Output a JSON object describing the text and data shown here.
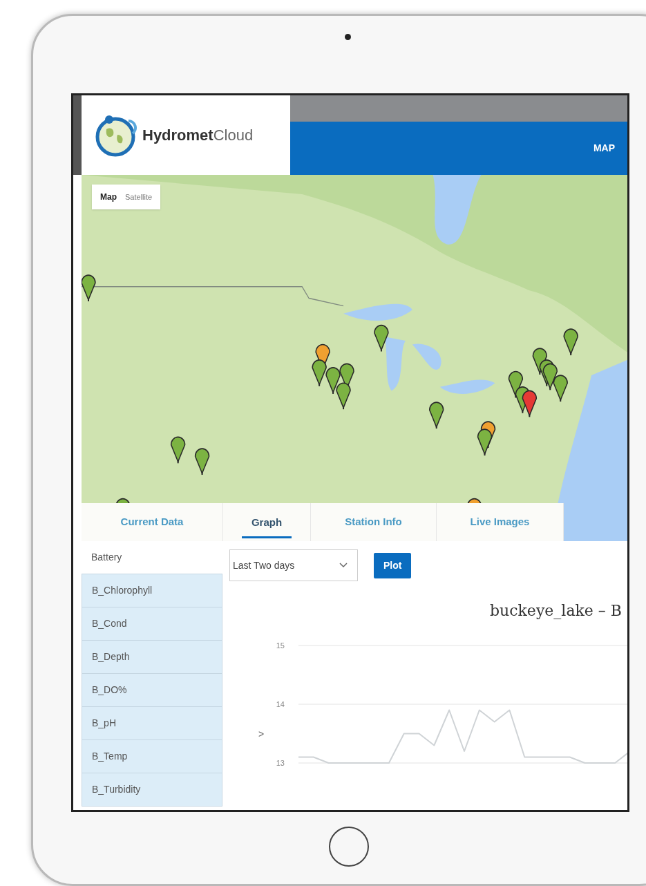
{
  "header": {
    "logo": {
      "name_bold": "Hydromet",
      "name_light": "Cloud"
    },
    "nav": [
      {
        "label": "MAP"
      }
    ]
  },
  "map": {
    "type_buttons": [
      {
        "label": "Map",
        "selected": true
      },
      {
        "label": "Satellite",
        "selected": false
      }
    ]
  },
  "tabs": [
    {
      "label": "Current Data",
      "selected": false
    },
    {
      "label": "Graph",
      "selected": true
    },
    {
      "label": "Station Info",
      "selected": false
    },
    {
      "label": "Live Images",
      "selected": false
    }
  ],
  "sidebar": {
    "items": [
      {
        "label": "Battery",
        "selected": true
      },
      {
        "label": "B_Chlorophyll",
        "selected": false
      },
      {
        "label": "B_Cond",
        "selected": false
      },
      {
        "label": "B_Depth",
        "selected": false
      },
      {
        "label": "B_DO%",
        "selected": false
      },
      {
        "label": "B_pH",
        "selected": false
      },
      {
        "label": "B_Temp",
        "selected": false
      },
      {
        "label": "B_Turbidity",
        "selected": false
      }
    ]
  },
  "graph": {
    "range": {
      "value": "Last Two days"
    },
    "plot_button": "Plot",
    "chart_data": {
      "type": "line",
      "title": "buckeye_lake – B",
      "ylabel": ">",
      "ylim": [
        13,
        15
      ],
      "yticks": [
        13,
        14,
        15
      ],
      "grid": true,
      "series": [
        {
          "color": "#cfd3d6",
          "values": [
            13.1,
            13.1,
            13.0,
            13.0,
            13.0,
            13.0,
            13.0,
            13.5,
            13.5,
            13.3,
            13.9,
            13.2,
            13.9,
            13.7,
            13.9,
            13.1,
            13.1,
            13.1,
            13.1,
            13.0,
            13.0,
            13.0,
            13.2
          ]
        }
      ]
    }
  }
}
